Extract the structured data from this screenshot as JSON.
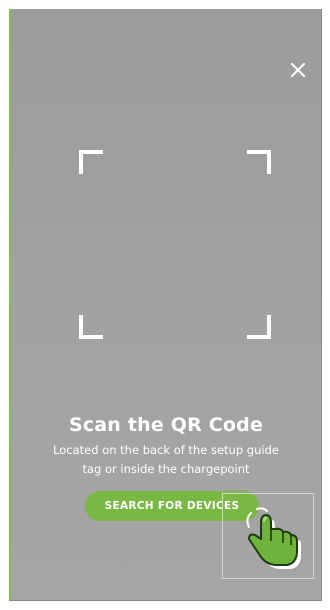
{
  "scanner": {
    "close_icon": "close-icon",
    "frame_icon": "qr-viewfinder-corners",
    "title": "Scan the QR Code",
    "subtitle_line1": "Located on the back of the setup guide",
    "subtitle_line2": "tag or inside the chargepoint",
    "search_button_label": "SEARCH FOR DEVICES"
  },
  "overlay": {
    "hint_icon": "pointing-hand-icon"
  },
  "colors": {
    "accent": "#78b843",
    "accent_border": "#7dc242",
    "camera_background": "#9e9f9e",
    "text": "#ffffff"
  }
}
